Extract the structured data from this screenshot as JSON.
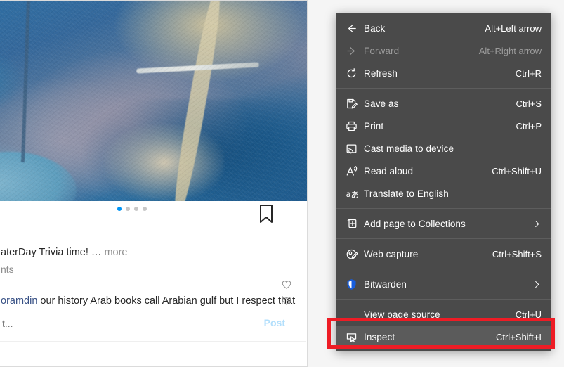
{
  "page": {
    "post": {
      "carousel_dots": 4,
      "active_dot_index": 0,
      "caption": "aterDay Trivia time! …",
      "caption_more_label": "more",
      "comment_count_text": "nts",
      "comments": [
        {
          "username": "oramdin",
          "text": "our history Arab books call Arabian gulf but I respect that"
        }
      ],
      "composer_placeholder": "t...",
      "post_button_label": "Post",
      "bookmark_icon": "bookmark-icon",
      "like_icon": "heart-icon"
    }
  },
  "context_menu": {
    "items": [
      {
        "id": "back",
        "label": "Back",
        "accel": "Alt+Left arrow",
        "icon": "arrow-left-icon",
        "disabled": false,
        "submenu": false,
        "hover": false
      },
      {
        "id": "forward",
        "label": "Forward",
        "accel": "Alt+Right arrow",
        "icon": "arrow-right-icon",
        "disabled": true,
        "submenu": false,
        "hover": false
      },
      {
        "id": "refresh",
        "label": "Refresh",
        "accel": "Ctrl+R",
        "icon": "refresh-icon",
        "disabled": false,
        "submenu": false,
        "hover": false
      },
      {
        "id": "separator-1",
        "label": "",
        "accel": "",
        "icon": "",
        "separator": true
      },
      {
        "id": "save-as",
        "label": "Save as",
        "accel": "Ctrl+S",
        "icon": "save-icon",
        "disabled": false,
        "submenu": false,
        "hover": false
      },
      {
        "id": "print",
        "label": "Print",
        "accel": "Ctrl+P",
        "icon": "printer-icon",
        "disabled": false,
        "submenu": false,
        "hover": false
      },
      {
        "id": "cast-media-to-device",
        "label": "Cast media to device",
        "accel": "",
        "icon": "cast-icon",
        "disabled": false,
        "submenu": false,
        "hover": false
      },
      {
        "id": "read-aloud",
        "label": "Read aloud",
        "accel": "Ctrl+Shift+U",
        "icon": "read-aloud-icon",
        "disabled": false,
        "submenu": false,
        "hover": false
      },
      {
        "id": "translate-to-english",
        "label": "Translate to English",
        "accel": "",
        "icon": "translate-icon",
        "disabled": false,
        "submenu": false,
        "hover": false
      },
      {
        "id": "separator-2",
        "label": "",
        "accel": "",
        "icon": "",
        "separator": true
      },
      {
        "id": "add-page-to-collections",
        "label": "Add page to Collections",
        "accel": "",
        "icon": "collections-icon",
        "disabled": false,
        "submenu": true,
        "hover": false
      },
      {
        "id": "separator-3",
        "label": "",
        "accel": "",
        "icon": "",
        "separator": true
      },
      {
        "id": "web-capture",
        "label": "Web capture",
        "accel": "Ctrl+Shift+S",
        "icon": "web-capture-icon",
        "disabled": false,
        "submenu": false,
        "hover": false
      },
      {
        "id": "separator-4",
        "label": "",
        "accel": "",
        "icon": "",
        "separator": true
      },
      {
        "id": "bitwarden",
        "label": "Bitwarden",
        "accel": "",
        "icon": "bitwarden-shield-icon",
        "disabled": false,
        "submenu": true,
        "hover": false
      },
      {
        "id": "separator-5",
        "label": "",
        "accel": "",
        "icon": "",
        "separator": true
      },
      {
        "id": "view-page-source",
        "label": "View page source",
        "accel": "Ctrl+U",
        "icon": "",
        "disabled": false,
        "submenu": false,
        "hover": false
      },
      {
        "id": "inspect",
        "label": "Inspect",
        "accel": "Ctrl+Shift+I",
        "icon": "inspect-icon",
        "disabled": false,
        "submenu": false,
        "hover": true
      }
    ]
  },
  "annotation": {
    "highlight_target": "inspect",
    "highlight_color": "#ee1c25"
  },
  "colors": {
    "menu_background": "#4a4a4a",
    "menu_hover": "#5b5b5b",
    "menu_text": "#ffffff",
    "menu_disabled_text": "#9b9b9b",
    "separator": "#5d5d5d",
    "accent_blue": "#0095f6",
    "post_button": "#b2dffc",
    "comment_username": "#385185",
    "highlight_red": "#ee1c25"
  }
}
